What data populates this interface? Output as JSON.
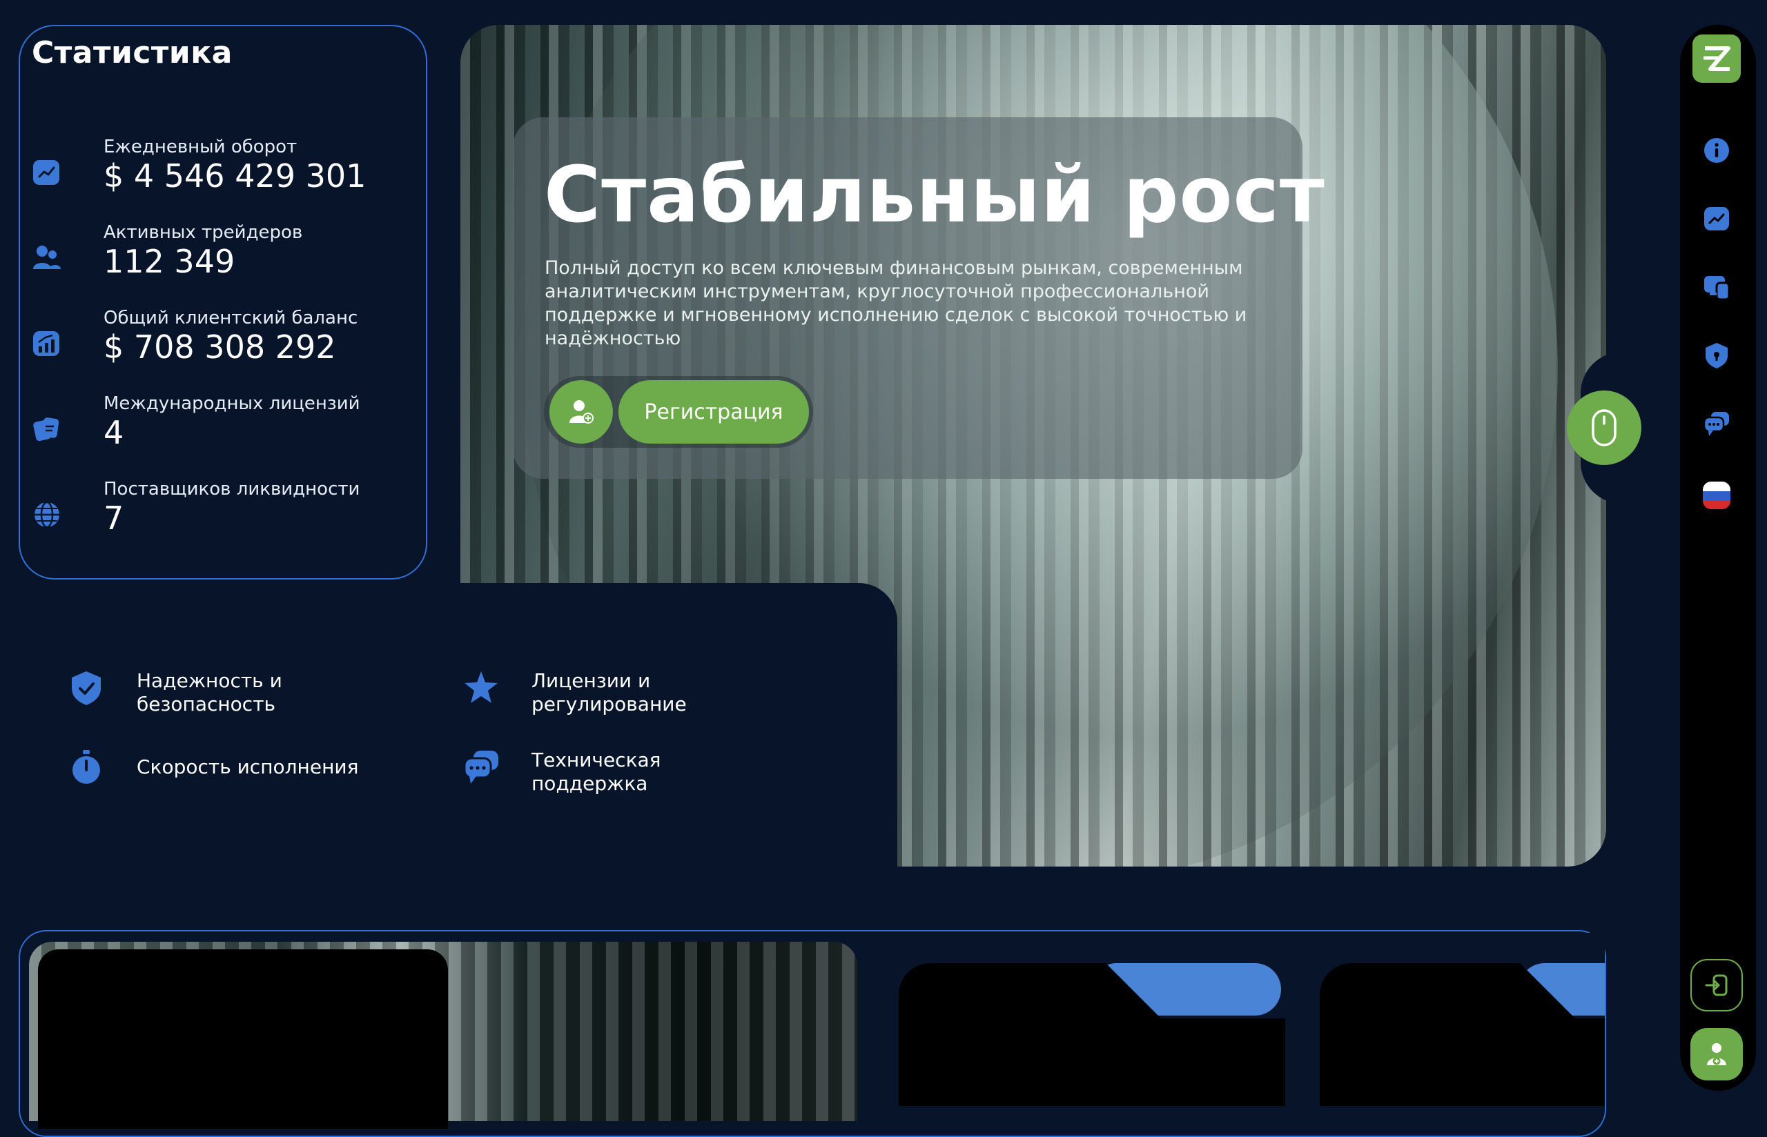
{
  "stats": {
    "title": "Статистика",
    "items": [
      {
        "label": "Ежедневный оборот",
        "value": "$ 4 546 429 301",
        "icon": "trend-chart-icon"
      },
      {
        "label": "Активных трейдеров",
        "value": "112 349",
        "icon": "users-icon"
      },
      {
        "label": "Общий клиентский баланс",
        "value": "$ 708 308 292",
        "icon": "bar-growth-icon"
      },
      {
        "label": "Международных лицензий",
        "value": "4",
        "icon": "license-icon"
      },
      {
        "label": "Поставщиков ликвидности",
        "value": "7",
        "icon": "globe-icon"
      }
    ]
  },
  "hero": {
    "title": "Стабильный рост",
    "description": "Полный доступ ко всем ключевым финансовым рынкам, современным аналитическим инструментам, круглосуточной профессиональной поддержке и мгновенному исполнению сделок с высокой точностью и надёжностью",
    "register_label": "Регистрация"
  },
  "features": [
    {
      "label": "Надежность и\nбезопасность",
      "icon": "shield-check-icon"
    },
    {
      "label": "Лицензии и\nрегулирование",
      "icon": "star-badge-icon"
    },
    {
      "label": "Скорость исполнения",
      "icon": "stopwatch-icon"
    },
    {
      "label": "Техническая\nподдержка",
      "icon": "chat-bubbles-icon"
    }
  ],
  "sidebar": {
    "logo": "logo-icon",
    "items": [
      "info-icon",
      "trend-chart-icon",
      "devices-icon",
      "shield-icon",
      "chat-icon",
      "russian-flag-icon"
    ],
    "login_icon": "login-icon",
    "signup_icon": "add-user-icon"
  },
  "colors": {
    "background": "#08142a",
    "accent_green": "#6eab4a",
    "accent_blue": "#2f6fd6",
    "icon_blue": "#3b78d8"
  }
}
